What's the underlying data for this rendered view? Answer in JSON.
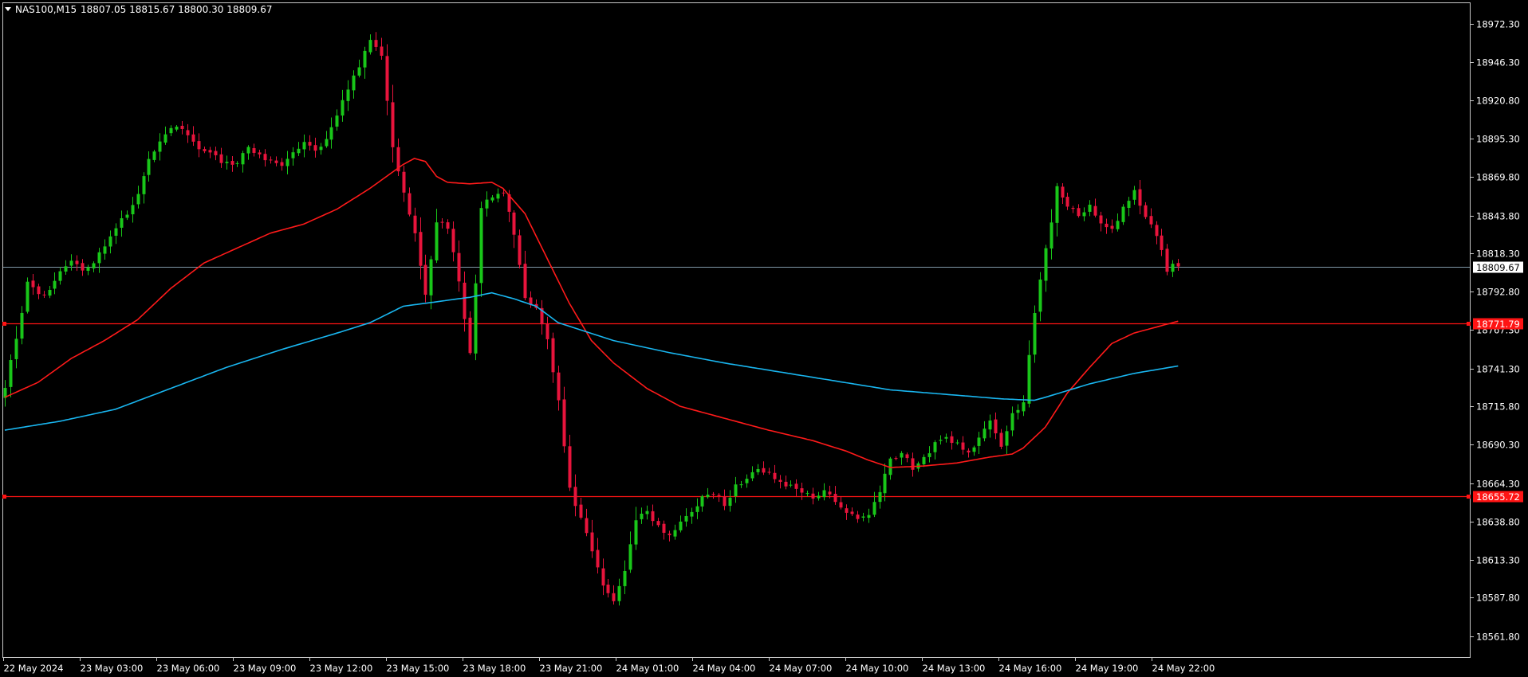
{
  "header": {
    "symbol_label": "NAS100,M15",
    "ohlc_text": "18807.05 18815.67 18800.30 18809.67"
  },
  "colors": {
    "background": "#000000",
    "frame": "#c8c8c8",
    "text": "#ffffff",
    "bull": "#19c619",
    "bear": "#e8143c",
    "ma_fast": "#ff1a1a",
    "ma_slow": "#19b6f0",
    "level_line": "#ff1414",
    "bid_line": "#7f98a8"
  },
  "chart_data": {
    "type": "candlestick",
    "symbol": "NAS100",
    "timeframe": "M15",
    "ylim": [
      18548.0,
      18986.0
    ],
    "y_ticks": [
      18972.3,
      18946.3,
      18920.8,
      18895.3,
      18869.8,
      18843.8,
      18818.3,
      18792.8,
      18767.3,
      18741.3,
      18715.8,
      18690.3,
      18664.3,
      18638.8,
      18613.3,
      18587.8,
      18561.8
    ],
    "x_ticks": [
      "22 May 2024",
      "23 May 03:00",
      "23 May 06:00",
      "23 May 09:00",
      "23 May 12:00",
      "23 May 15:00",
      "23 May 18:00",
      "23 May 21:00",
      "24 May 01:00",
      "24 May 04:00",
      "24 May 07:00",
      "24 May 10:00",
      "24 May 13:00",
      "24 May 16:00",
      "24 May 19:00",
      "24 May 22:00"
    ],
    "current_price": 18809.67,
    "levels": [
      18771.79,
      18655.72
    ],
    "close_path": [
      [
        0,
        18730
      ],
      [
        2,
        18760
      ],
      [
        4,
        18800
      ],
      [
        6,
        18790
      ],
      [
        8,
        18795
      ],
      [
        10,
        18805
      ],
      [
        12,
        18815
      ],
      [
        14,
        18808
      ],
      [
        16,
        18810
      ],
      [
        18,
        18825
      ],
      [
        20,
        18835
      ],
      [
        22,
        18845
      ],
      [
        24,
        18860
      ],
      [
        26,
        18880
      ],
      [
        28,
        18895
      ],
      [
        30,
        18903
      ],
      [
        32,
        18900
      ],
      [
        34,
        18892
      ],
      [
        36,
        18888
      ],
      [
        38,
        18883
      ],
      [
        40,
        18878
      ],
      [
        42,
        18880
      ],
      [
        44,
        18888
      ],
      [
        46,
        18885
      ],
      [
        48,
        18880
      ],
      [
        50,
        18876
      ],
      [
        52,
        18885
      ],
      [
        54,
        18895
      ],
      [
        56,
        18888
      ],
      [
        58,
        18895
      ],
      [
        60,
        18912
      ],
      [
        62,
        18930
      ],
      [
        64,
        18945
      ],
      [
        66,
        18960
      ],
      [
        68,
        18950
      ],
      [
        70,
        18890
      ],
      [
        72,
        18860
      ],
      [
        74,
        18830
      ],
      [
        76,
        18790
      ],
      [
        78,
        18840
      ],
      [
        80,
        18835
      ],
      [
        82,
        18800
      ],
      [
        84,
        18750
      ],
      [
        86,
        18850
      ],
      [
        88,
        18855
      ],
      [
        90,
        18860
      ],
      [
        92,
        18830
      ],
      [
        94,
        18790
      ],
      [
        96,
        18780
      ],
      [
        98,
        18760
      ],
      [
        100,
        18720
      ],
      [
        102,
        18660
      ],
      [
        104,
        18640
      ],
      [
        106,
        18620
      ],
      [
        108,
        18595
      ],
      [
        110,
        18585
      ],
      [
        112,
        18605
      ],
      [
        114,
        18640
      ],
      [
        116,
        18645
      ],
      [
        118,
        18635
      ],
      [
        120,
        18630
      ],
      [
        122,
        18640
      ],
      [
        124,
        18645
      ],
      [
        126,
        18655
      ],
      [
        128,
        18658
      ],
      [
        130,
        18650
      ],
      [
        132,
        18662
      ],
      [
        134,
        18668
      ],
      [
        136,
        18672
      ],
      [
        138,
        18670
      ],
      [
        140,
        18666
      ],
      [
        142,
        18662
      ],
      [
        144,
        18658
      ],
      [
        146,
        18656
      ],
      [
        148,
        18660
      ],
      [
        150,
        18652
      ],
      [
        152,
        18645
      ],
      [
        154,
        18640
      ],
      [
        156,
        18645
      ],
      [
        158,
        18660
      ],
      [
        160,
        18680
      ],
      [
        162,
        18685
      ],
      [
        164,
        18675
      ],
      [
        166,
        18683
      ],
      [
        168,
        18690
      ],
      [
        170,
        18695
      ],
      [
        172,
        18690
      ],
      [
        174,
        18685
      ],
      [
        176,
        18695
      ],
      [
        178,
        18705
      ],
      [
        180,
        18690
      ],
      [
        182,
        18710
      ],
      [
        184,
        18720
      ],
      [
        186,
        18780
      ],
      [
        188,
        18820
      ],
      [
        190,
        18862
      ],
      [
        192,
        18850
      ],
      [
        194,
        18845
      ],
      [
        196,
        18850
      ],
      [
        198,
        18840
      ],
      [
        200,
        18835
      ],
      [
        202,
        18848
      ],
      [
        204,
        18860
      ],
      [
        206,
        18842
      ],
      [
        208,
        18830
      ],
      [
        210,
        18808
      ],
      [
        212,
        18812
      ]
    ],
    "series": [
      {
        "name": "",
        "color": "#ff1a1a",
        "points": [
          [
            0,
            18722
          ],
          [
            6,
            18732
          ],
          [
            12,
            18748
          ],
          [
            18,
            18760
          ],
          [
            24,
            18774
          ],
          [
            30,
            18795
          ],
          [
            36,
            18812
          ],
          [
            42,
            18822
          ],
          [
            48,
            18832
          ],
          [
            54,
            18838
          ],
          [
            60,
            18848
          ],
          [
            66,
            18862
          ],
          [
            72,
            18878
          ],
          [
            74,
            18882
          ],
          [
            76,
            18880
          ],
          [
            78,
            18870
          ],
          [
            80,
            18866
          ],
          [
            84,
            18865
          ],
          [
            88,
            18866
          ],
          [
            90,
            18862
          ],
          [
            94,
            18845
          ],
          [
            98,
            18815
          ],
          [
            102,
            18785
          ],
          [
            106,
            18760
          ],
          [
            110,
            18745
          ],
          [
            116,
            18728
          ],
          [
            122,
            18716
          ],
          [
            130,
            18708
          ],
          [
            138,
            18700
          ],
          [
            146,
            18693
          ],
          [
            152,
            18686
          ],
          [
            156,
            18680
          ],
          [
            160,
            18675
          ],
          [
            166,
            18676
          ],
          [
            172,
            18678
          ],
          [
            178,
            18682
          ],
          [
            182,
            18684
          ],
          [
            184,
            18688
          ],
          [
            188,
            18702
          ],
          [
            192,
            18725
          ],
          [
            196,
            18742
          ],
          [
            200,
            18758
          ],
          [
            204,
            18765
          ],
          [
            208,
            18769
          ],
          [
            212,
            18773
          ]
        ]
      },
      {
        "name": "",
        "color": "#19b6f0",
        "points": [
          [
            0,
            18700
          ],
          [
            10,
            18706
          ],
          [
            20,
            18714
          ],
          [
            30,
            18728
          ],
          [
            40,
            18742
          ],
          [
            50,
            18754
          ],
          [
            60,
            18765
          ],
          [
            66,
            18772
          ],
          [
            72,
            18783
          ],
          [
            78,
            18786
          ],
          [
            84,
            18789
          ],
          [
            88,
            18792
          ],
          [
            92,
            18788
          ],
          [
            96,
            18783
          ],
          [
            100,
            18772
          ],
          [
            110,
            18760
          ],
          [
            120,
            18752
          ],
          [
            130,
            18745
          ],
          [
            140,
            18739
          ],
          [
            150,
            18733
          ],
          [
            160,
            18727
          ],
          [
            170,
            18724
          ],
          [
            180,
            18721
          ],
          [
            186,
            18720
          ],
          [
            188,
            18722
          ],
          [
            196,
            18731
          ],
          [
            204,
            18738
          ],
          [
            212,
            18743
          ]
        ]
      }
    ]
  }
}
